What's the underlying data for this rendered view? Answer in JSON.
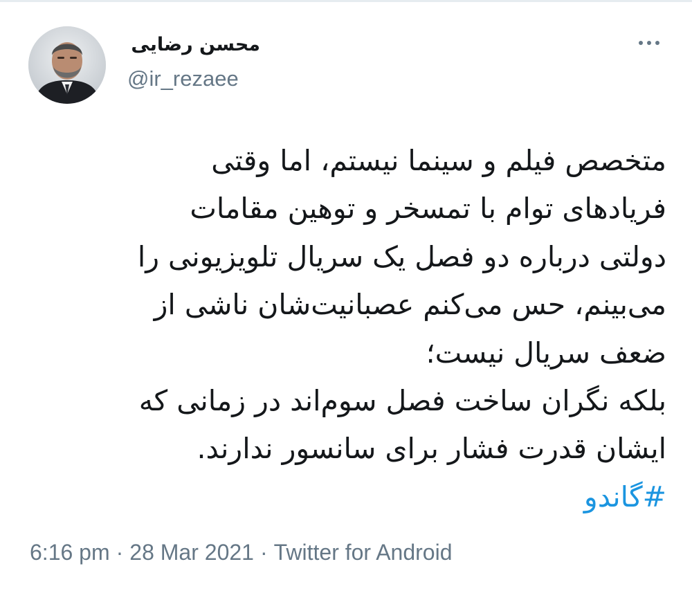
{
  "author": {
    "display_name": "محسن رضایی",
    "handle": "@ir_rezaee",
    "avatar_icon": "profile-photo"
  },
  "header": {
    "more_icon": "more-dots-icon"
  },
  "tweet": {
    "lines": [
      "متخصص فیلم و سینما نیستم، اما وقتی",
      "فریادهای توام با تمسخر و توهین مقامات",
      "دولتی درباره دو فصل یک سریال تلویزیونی را",
      "می‌بینم، حس می‌کنم عصبانیت‌شان ناشی از",
      "ضعف سریال نیست؛",
      "بلکه نگران ساخت فصل سوم‌اند در زمانی که",
      "ایشان قدرت فشار برای سانسور ندارند."
    ],
    "hashtag": "#گاندو"
  },
  "meta": {
    "time": "6:16 pm",
    "separator": "·",
    "date": "28 Mar 2021",
    "source": "Twitter for Android"
  },
  "colors": {
    "text": "#14171a",
    "secondary": "#657786",
    "link": "#1b95e0"
  }
}
